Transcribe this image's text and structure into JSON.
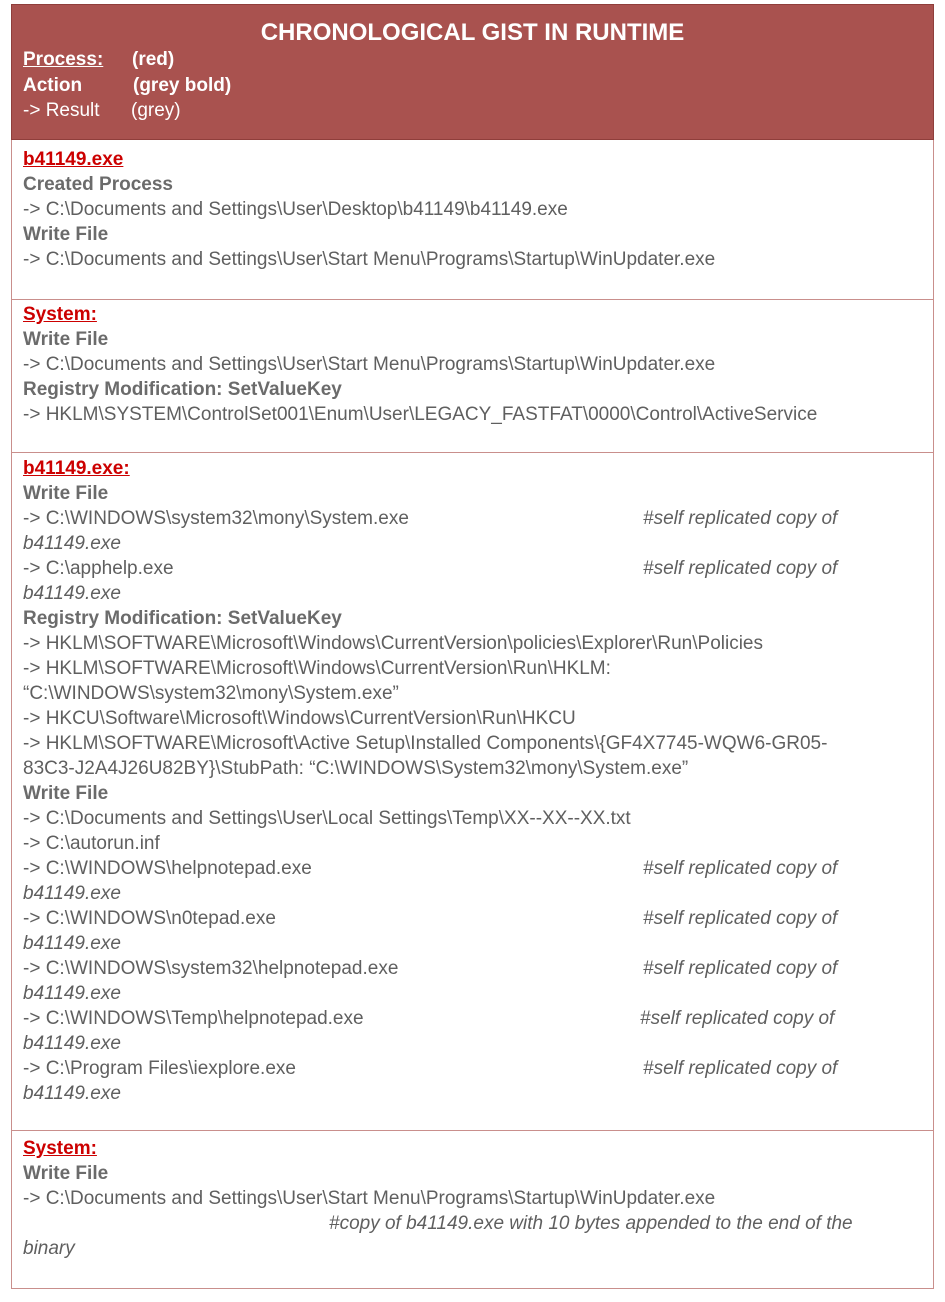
{
  "header": {
    "title": "CHRONOLOGICAL GIST IN RUNTIME",
    "legend": [
      {
        "key": "Process:",
        "value": "(red)"
      },
      {
        "key": "Action",
        "value": "(grey bold)"
      },
      {
        "key": "-> Result",
        "value": "(grey)"
      }
    ]
  },
  "s1": {
    "process": "b41149.exe",
    "a1": "Created Process",
    "r1": "-> C:\\Documents and Settings\\User\\Desktop\\b41149\\b41149.exe",
    "a2": "Write File",
    "r2": "-> C:\\Documents and Settings\\User\\Start Menu\\Programs\\Startup\\WinUpdater.exe"
  },
  "s2": {
    "process": "System:",
    "a1": "Write File",
    "r1": "-> C:\\Documents and Settings\\User\\Start Menu\\Programs\\Startup\\WinUpdater.exe",
    "a2": "Registry Modification: SetValueKey",
    "r2": "-> HKLM\\SYSTEM\\ControlSet001\\Enum\\User\\LEGACY_FASTFAT\\0000\\Control\\ActiveService"
  },
  "s3": {
    "process": "b41149.exe:",
    "a1": "Write File",
    "w1": [
      {
        "path": "-> C:\\WINDOWS\\system32\\mony\\System.exe",
        "comment": "#self replicated copy of",
        "cont": "b41149.exe"
      },
      {
        "path": "-> C:\\apphelp.exe",
        "comment": "#self replicated copy of",
        "cont": "b41149.exe"
      }
    ],
    "a2": "Registry Modification: SetValueKey",
    "reg": [
      "-> HKLM\\SOFTWARE\\Microsoft\\Windows\\CurrentVersion\\policies\\Explorer\\Run\\Policies",
      "-> HKLM\\SOFTWARE\\Microsoft\\Windows\\CurrentVersion\\Run\\HKLM:",
      "“C:\\WINDOWS\\system32\\mony\\System.exe”",
      "-> HKCU\\Software\\Microsoft\\Windows\\CurrentVersion\\Run\\HKCU",
      "-> HKLM\\SOFTWARE\\Microsoft\\Active Setup\\Installed Components\\{GF4X7745-WQW6-GR05-",
      "83C3-J2A4J26U82BY}\\StubPath:  “C:\\WINDOWS\\System32\\mony\\System.exe”"
    ],
    "a3": "Write File",
    "w2_plain": [
      "-> C:\\Documents and Settings\\User\\Local Settings\\Temp\\XX--XX--XX.txt",
      "-> C:\\autorun.inf"
    ],
    "w2": [
      {
        "path": "-> C:\\WINDOWS\\helpnotepad.exe",
        "comment": "#self replicated copy of",
        "cont": "b41149.exe"
      },
      {
        "path": "-> C:\\WINDOWS\\n0tepad.exe",
        "comment": "#self replicated copy of",
        "cont": "b41149.exe"
      },
      {
        "path": "-> C:\\WINDOWS\\system32\\helpnotepad.exe",
        "comment": "#self replicated copy of",
        "cont": "b41149.exe"
      },
      {
        "path": "-> C:\\WINDOWS\\Temp\\helpnotepad.exe",
        "comment": "#self replicated copy of",
        "cont": "b41149.exe"
      },
      {
        "path": "-> C:\\Program Files\\iexplore.exe",
        "comment": "#self replicated copy of",
        "cont": "b41149.exe"
      }
    ]
  },
  "s4": {
    "process": "System:",
    "a1": "Write File",
    "r1": "-> C:\\Documents and Settings\\User\\Start Menu\\Programs\\Startup\\WinUpdater.exe",
    "comment": "#copy of b41149.exe with 10 bytes appended to the end of the",
    "cont": "binary"
  }
}
